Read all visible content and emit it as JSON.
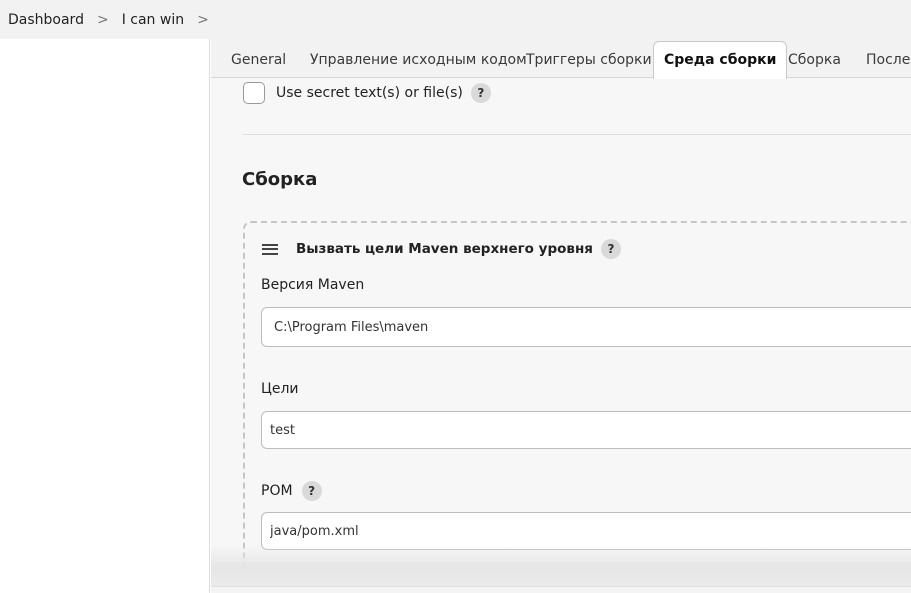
{
  "breadcrumb": {
    "items": [
      "Dashboard",
      "I can win"
    ],
    "separator": ">"
  },
  "tabs": [
    {
      "label": "General"
    },
    {
      "label": "Управление исходным кодом"
    },
    {
      "label": "Триггеры сборки"
    },
    {
      "label": "Среда сборки",
      "active": true
    },
    {
      "label": "Сборка"
    },
    {
      "label": "Послес"
    }
  ],
  "build_env": {
    "secret_checkbox_label": "Use secret text(s) or file(s)",
    "secret_checked": false
  },
  "help_glyph": "?",
  "build_section": {
    "title": "Сборка",
    "step": {
      "title": "Вызвать цели Maven верхнего уровня",
      "maven_version_label": "Версия Maven",
      "maven_version_value": "C:\\Program Files\\maven",
      "goals_label": "Цели",
      "goals_value": "test",
      "pom_label": "POM",
      "pom_value": "java/pom.xml"
    }
  },
  "colors": {
    "page_bg": "#f7f7f7",
    "topbar_bg": "#f2f2f2",
    "active_tab_bg": "#ffffff",
    "help_badge_bg": "#d9d9d9",
    "input_border": "#bdbdbd"
  },
  "icons": [
    "chevron-right-icon",
    "help-icon",
    "drag-handle-icon"
  ]
}
